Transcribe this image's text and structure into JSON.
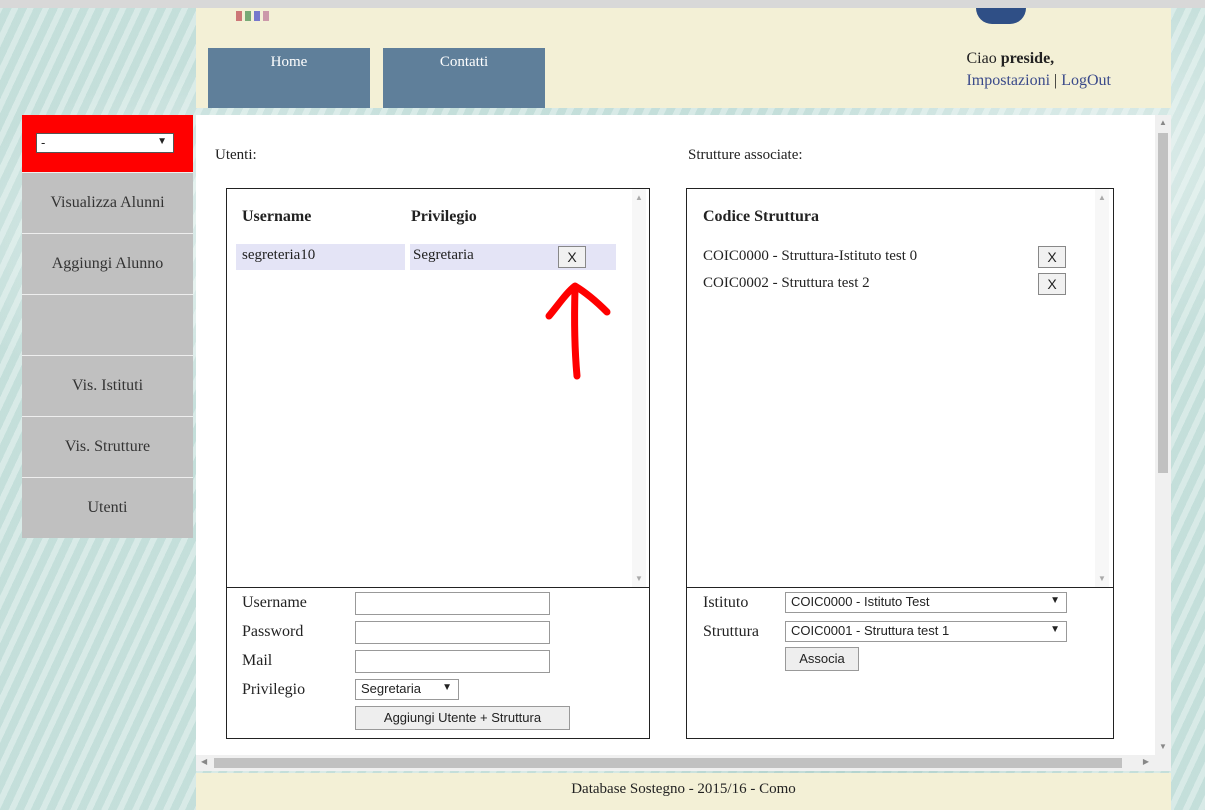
{
  "header": {
    "nav": [
      "Home",
      "Contatti"
    ],
    "greeting_prefix": "Ciao ",
    "greeting_user": "preside,",
    "settings_link": "Impostazioni",
    "separator": " | ",
    "logout_link": "LogOut"
  },
  "sidebar": {
    "select_value": "-",
    "items": [
      "Visualizza Alunni",
      "Aggiungi Alunno",
      "",
      "Vis. Istituti",
      "Vis. Strutture",
      "Utenti"
    ]
  },
  "users": {
    "title": "Utenti:",
    "col_username": "Username",
    "col_privilege": "Privilegio",
    "rows": [
      {
        "username": "segreteria10",
        "privilege": "Segretaria",
        "remove": "X"
      }
    ],
    "form": {
      "username_label": "Username",
      "password_label": "Password",
      "mail_label": "Mail",
      "privilege_label": "Privilegio",
      "privilege_value": "Segretaria",
      "submit_label": "Aggiungi Utente + Struttura"
    }
  },
  "structures": {
    "title": "Strutture associate:",
    "col_code": "Codice Struttura",
    "rows": [
      {
        "text": "COIC0000 - Struttura-Istituto test 0",
        "remove": "X"
      },
      {
        "text": "COIC0002 - Struttura test 2",
        "remove": "X"
      }
    ],
    "form": {
      "istituto_label": "Istituto",
      "istituto_value": "COIC0000 - Istituto Test",
      "struttura_label": "Struttura",
      "struttura_value": "COIC0001 - Struttura test 1",
      "associate_label": "Associa"
    }
  },
  "footer": "Database Sostegno - 2015/16 - Como",
  "colors": {
    "header_bg": "#f3f0d6",
    "nav_bg": "#5f7f9a",
    "sidebar_bg": "#c0c0c0",
    "sidebar_top": "#ff0000",
    "row_highlight": "#e4e4f6",
    "annotation": "#ff0000"
  }
}
